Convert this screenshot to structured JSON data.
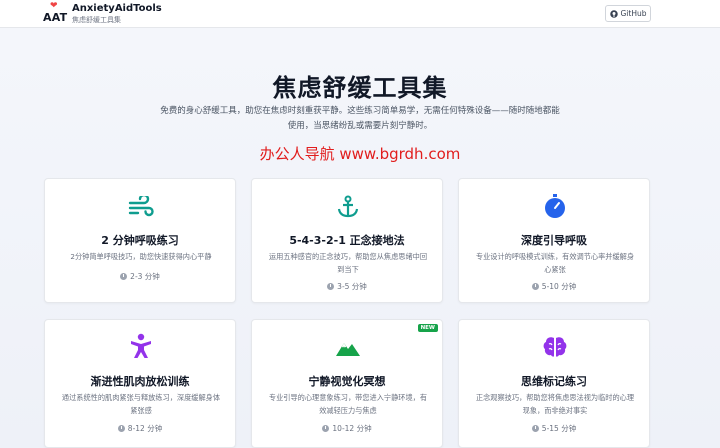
{
  "header": {
    "logo_text": "AAT",
    "brand_title": "AnxietyAidTools",
    "brand_subtitle": "焦虑舒缓工具集",
    "github_label": "GitHub"
  },
  "hero": {
    "title": "焦虑舒缓工具集",
    "description": "免费的身心舒缓工具，助您在焦虑时刻重获平静。这些练习简单易学，无需任何特殊设备——随时随地都能使用，当思绪纷乱或需要片刻宁静时。"
  },
  "watermark": "办公人导航 www.bgrdh.com",
  "colors": {
    "accent_teal": "#0f9d8f",
    "accent_blue": "#2563eb",
    "accent_purple": "#9333ea",
    "accent_green": "#16a34a"
  },
  "cards": [
    {
      "icon": "wind-icon",
      "title": "2 分钟呼吸练习",
      "description": "2分钟简单呼吸技巧，助您快速获得内心平静",
      "duration": "2-3 分钟"
    },
    {
      "icon": "anchor-icon",
      "title": "5-4-3-2-1 正念接地法",
      "description": "运用五种感官的正念技巧，帮助您从焦虑思绪中回到当下",
      "duration": "3-5 分钟"
    },
    {
      "icon": "stopwatch-icon",
      "title": "深度引导呼吸",
      "description": "专业设计的呼吸模式训练，有效调节心率并缓解身心紧张",
      "duration": "5-10 分钟"
    },
    {
      "icon": "person-relax-icon",
      "title": "渐进性肌肉放松训练",
      "description": "通过系统性的肌肉紧张与释放练习，深度缓解身体紧张感",
      "duration": "8-12 分钟"
    },
    {
      "icon": "mountain-icon",
      "title": "宁静视觉化冥想",
      "description": "专业引导的心理意象练习，带您进入宁静环境，有效减轻压力与焦虑",
      "duration": "10-12 分钟",
      "badge": "NEW"
    },
    {
      "icon": "brain-icon",
      "title": "思维标记练习",
      "description": "正念观察技巧，帮助您将焦虑思法视为临时的心理现象，而非绝对事实",
      "duration": "5-15 分钟"
    }
  ]
}
